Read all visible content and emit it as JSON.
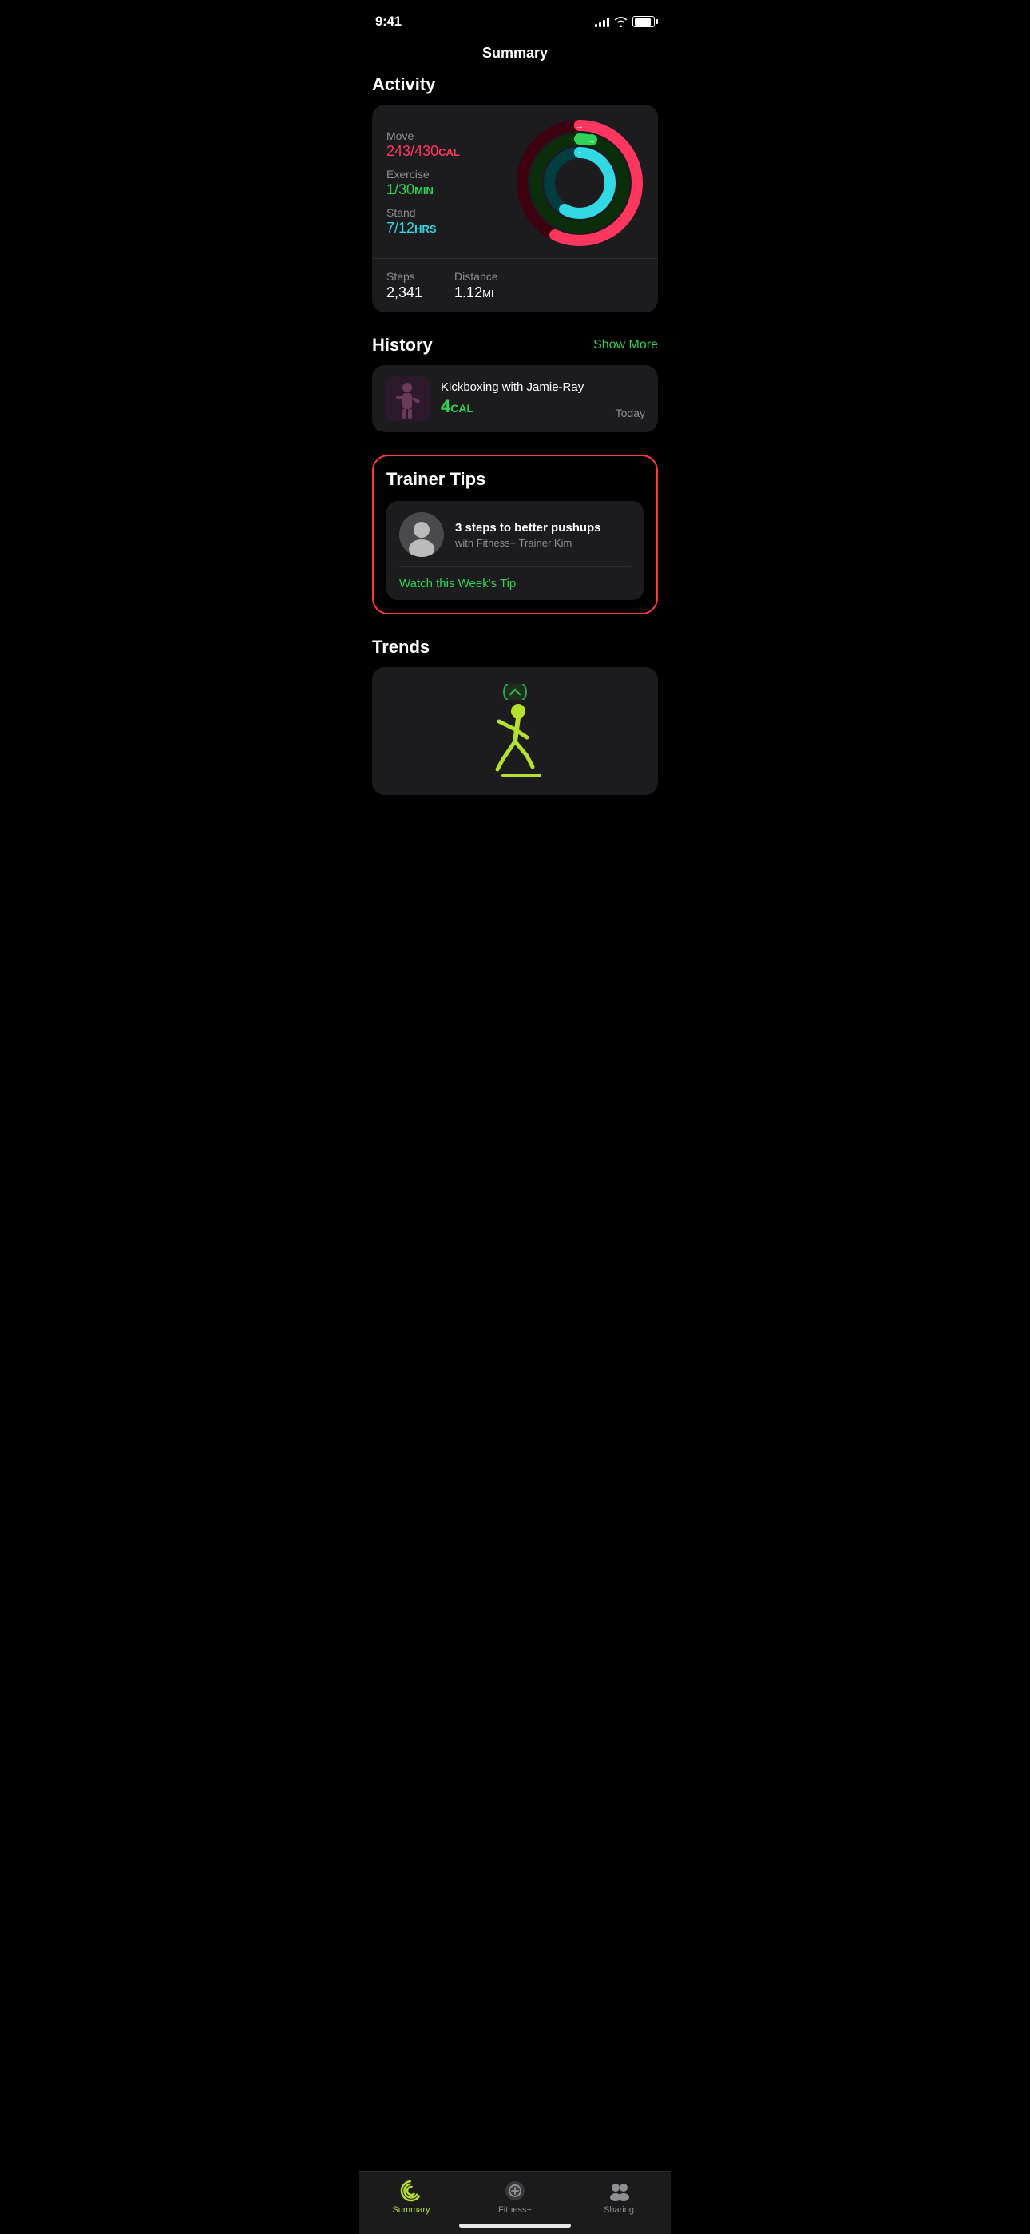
{
  "statusBar": {
    "time": "9:41",
    "signalBars": [
      4,
      6,
      8,
      10,
      12
    ],
    "batteryLevel": 90
  },
  "pageTitle": "Summary",
  "activity": {
    "sectionLabel": "Activity",
    "move": {
      "label": "Move",
      "current": "243",
      "goal": "430",
      "unit": "CAL",
      "color": "#ff375f"
    },
    "exercise": {
      "label": "Exercise",
      "current": "1",
      "goal": "30",
      "unit": "MIN",
      "color": "#30d158"
    },
    "stand": {
      "label": "Stand",
      "current": "7",
      "goal": "12",
      "unit": "HRS",
      "color": "#32d8e2"
    },
    "steps": {
      "label": "Steps",
      "value": "2,341"
    },
    "distance": {
      "label": "Distance",
      "value": "1.12",
      "unit": "MI"
    }
  },
  "history": {
    "sectionLabel": "History",
    "showMoreLabel": "Show More",
    "items": [
      {
        "title": "Kickboxing with Jamie-Ray",
        "calories": "4",
        "calUnit": "CAL",
        "date": "Today"
      }
    ]
  },
  "trainerTips": {
    "sectionLabel": "Trainer Tips",
    "tipTitle": "3 steps to better pushups",
    "tipSubtitle": "with Fitness+ Trainer Kim",
    "watchLabel": "Watch this Week's Tip"
  },
  "trends": {
    "sectionLabel": "Trends"
  },
  "tabBar": {
    "tabs": [
      {
        "id": "summary",
        "label": "Summary",
        "active": true
      },
      {
        "id": "fitness-plus",
        "label": "Fitness+",
        "active": false
      },
      {
        "id": "sharing",
        "label": "Sharing",
        "active": false
      }
    ]
  }
}
